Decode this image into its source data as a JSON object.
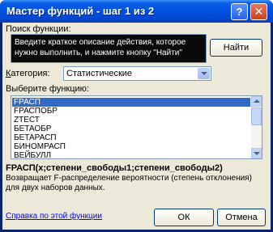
{
  "window": {
    "title": "Мастер функций - шаг 1 из 2",
    "help_glyph": "?",
    "close_glyph": "✕"
  },
  "search": {
    "label": "Поиск функции:",
    "value": "Введите краткое описание действия, которое нужно выполнить, и нажмите кнопку \"Найти\"",
    "find_label": "Найти"
  },
  "category": {
    "label_prefix": "К",
    "label_rest": "атегория:",
    "selected": "Статистические"
  },
  "functions": {
    "label": "Выберите функцию:",
    "items": [
      "FРАСП",
      "FРАСПОБР",
      "ZТЕСТ",
      "БЕТАОБР",
      "БЕТАРАСП",
      "БИНОМРАСП",
      "ВЕЙБУЛЛ"
    ],
    "selected_index": 0
  },
  "details": {
    "signature": "FРАСП(x;степени_свободы1;степени_свободы2)",
    "description": "Возвращает F-распределение вероятности (степень отклонения) для двух наборов данных."
  },
  "footer": {
    "help_link": "Справка по этой функции",
    "ok_label": "ОК",
    "cancel_label": "Отмена"
  }
}
